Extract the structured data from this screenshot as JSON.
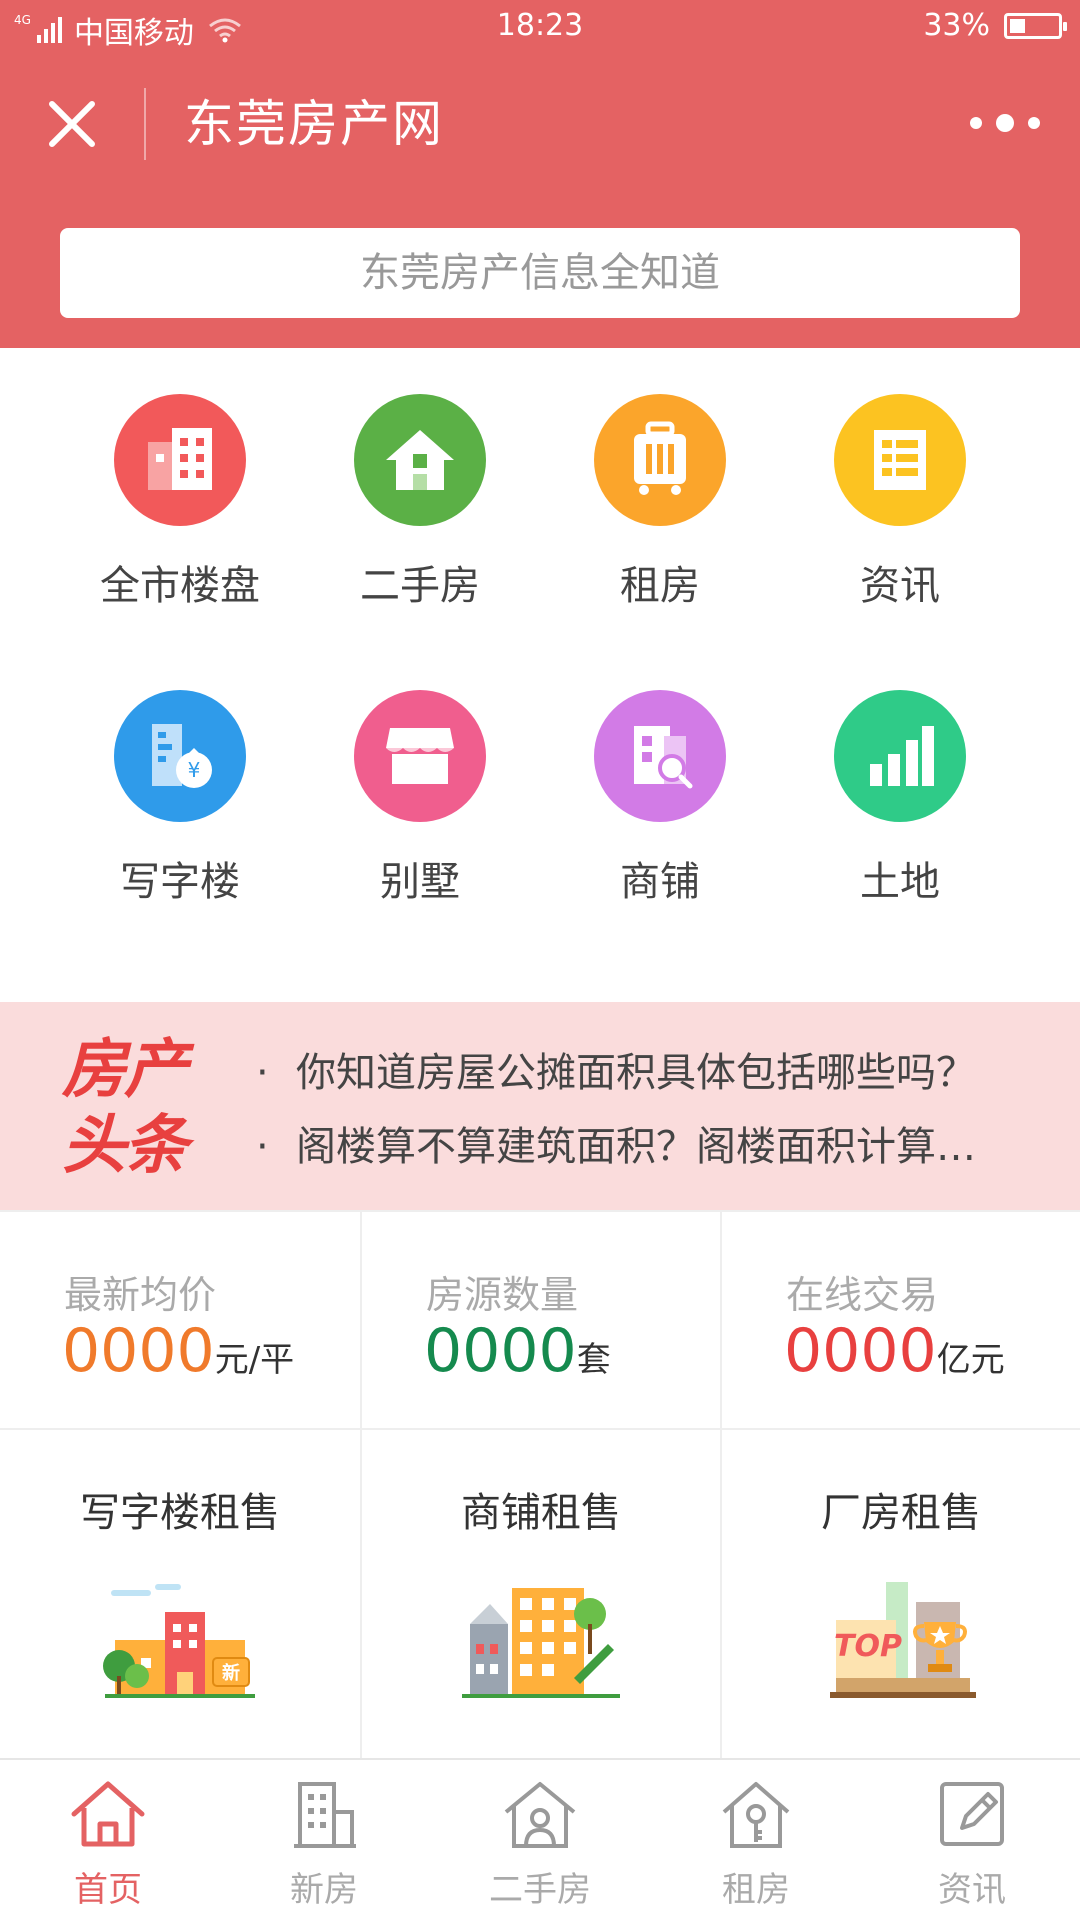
{
  "status_bar": {
    "network": "4G",
    "carrier": "中国移动",
    "time": "18:23",
    "battery": "33%",
    "battery_level": 0.33
  },
  "navbar": {
    "title": "东莞房产网"
  },
  "search": {
    "placeholder": "东莞房产信息全知道"
  },
  "categories": [
    {
      "label": "全市楼盘",
      "icon": "buildings-icon",
      "color": "#f2595a"
    },
    {
      "label": "二手房",
      "icon": "house-icon",
      "color": "#5bb046"
    },
    {
      "label": "租房",
      "icon": "luggage-icon",
      "color": "#fba52b"
    },
    {
      "label": "资讯",
      "icon": "news-icon",
      "color": "#fcc321"
    },
    {
      "label": "写字楼",
      "icon": "office-money-icon",
      "color": "#2f9bea"
    },
    {
      "label": "别墅",
      "icon": "shop-awning-icon",
      "color": "#f05e8e"
    },
    {
      "label": "商铺",
      "icon": "shop-search-icon",
      "color": "#d27be6"
    },
    {
      "label": "土地",
      "icon": "bar-chart-icon",
      "color": "#2fcb88"
    }
  ],
  "headlines": {
    "logo_line1": "房产",
    "logo_line2": "头条",
    "bullet": "·",
    "items": [
      "你知道房屋公摊面积具体包括哪些吗？",
      "阁楼算不算建筑面积？阁楼面积计算…"
    ]
  },
  "stats": [
    {
      "label": "最新均价",
      "value": "0000",
      "unit": "元/平",
      "color": "#f07a2b"
    },
    {
      "label": "房源数量",
      "value": "0000",
      "unit": "套",
      "color": "#158a4e"
    },
    {
      "label": "在线交易",
      "value": "0000",
      "unit": "亿元",
      "color": "#e8403f"
    }
  ],
  "rental_cards": [
    {
      "title": "写字楼租售",
      "illustration": "new-building-illustration",
      "badge": "新"
    },
    {
      "title": "商铺租售",
      "illustration": "shop-building-illustration"
    },
    {
      "title": "厂房租售",
      "illustration": "top-trophy-illustration",
      "badge": "TOP"
    }
  ],
  "tabs": [
    {
      "label": "首页",
      "icon": "home-icon",
      "active": true
    },
    {
      "label": "新房",
      "icon": "building-icon",
      "active": false
    },
    {
      "label": "二手房",
      "icon": "house-outline-icon",
      "active": false
    },
    {
      "label": "租房",
      "icon": "key-house-icon",
      "active": false
    },
    {
      "label": "资讯",
      "icon": "edit-icon",
      "active": false
    }
  ],
  "colors": {
    "brand": "#e46263",
    "headline_bg": "#fadcdc",
    "active_tab": "#e46263",
    "inactive_tab": "#aaaaaa"
  }
}
